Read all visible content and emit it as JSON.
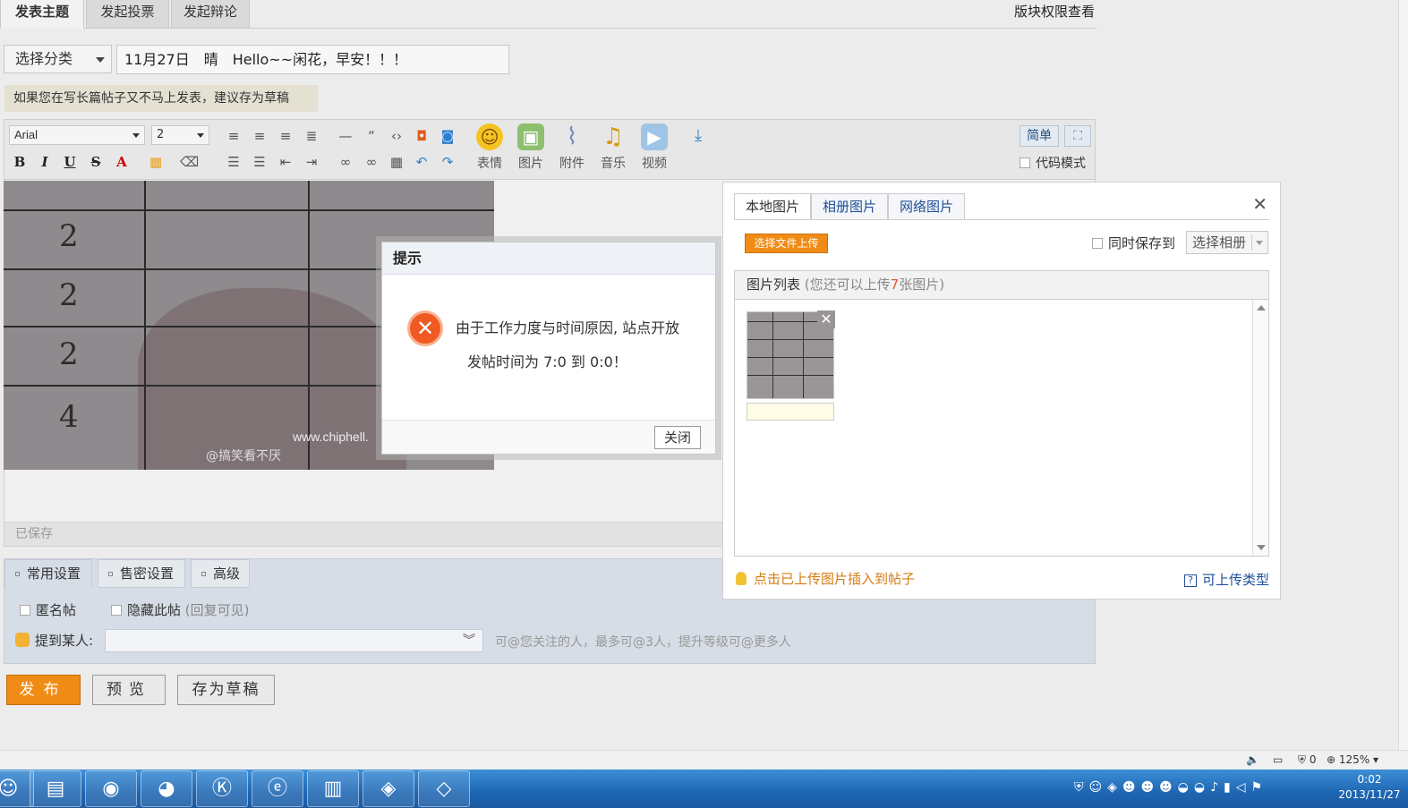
{
  "tabs": [
    "发表主题",
    "发起投票",
    "发起辩论"
  ],
  "perm_link": "版块权限查看",
  "category_select": "选择分类",
  "subject_value": "11月27日　晴　Hello~~闲花，早安！！！",
  "draft_tip": "如果您在写长篇帖子又不马上发表，建议存为草稿",
  "toolbar": {
    "font": "Arial",
    "size": "2",
    "tools": [
      "表情",
      "图片",
      "附件",
      "音乐",
      "视频"
    ],
    "simple": "简单",
    "code_mode": "代码模式"
  },
  "editor": {
    "photo_numbers": [
      "2",
      "2",
      "2",
      "4"
    ],
    "watermark_url": "www.chiphell.",
    "watermark_user": "@搞笑看不厌",
    "saved": "已保存"
  },
  "settings": {
    "tabs": [
      "常用设置",
      "售密设置",
      "高级"
    ],
    "anonymous": "匿名帖",
    "hide_post": "隐藏此帖",
    "hide_hint": "(回复可见)",
    "mention_label": "提到某人:",
    "mention_hint": "可@您关注的人，最多可@3人，提升等级可@更多人"
  },
  "buttons": {
    "publish": "发布",
    "preview": "预览",
    "save_draft": "存为草稿"
  },
  "alert": {
    "title": "提示",
    "message_line1": "由于工作力度与时间原因, 站点开放",
    "message_line2": "发帖时间为 7:0 到 0:0！",
    "close": "关闭"
  },
  "image_panel": {
    "tabs": [
      "本地图片",
      "相册图片",
      "网络图片"
    ],
    "upload_button": "选择文件上传",
    "save_to": "同时保存到",
    "album_select": "选择相册",
    "list_title": "图片列表",
    "list_sub_pre": "(您还可以上传",
    "list_sub_count": "7",
    "list_sub_post": "张图片)",
    "footer_tip": "点击已上传图片插入到帖子",
    "types_link": "可上传类型"
  },
  "statusbar": {
    "shield_count": "0",
    "zoom": "125%"
  },
  "clock": {
    "time": "0:02",
    "date": "2013/11/27"
  },
  "colors": {
    "accent_orange": "#f08c16",
    "link_blue": "#1f4f9a",
    "error_red": "#f05a22",
    "taskbar_blue": "#1f66b3"
  }
}
